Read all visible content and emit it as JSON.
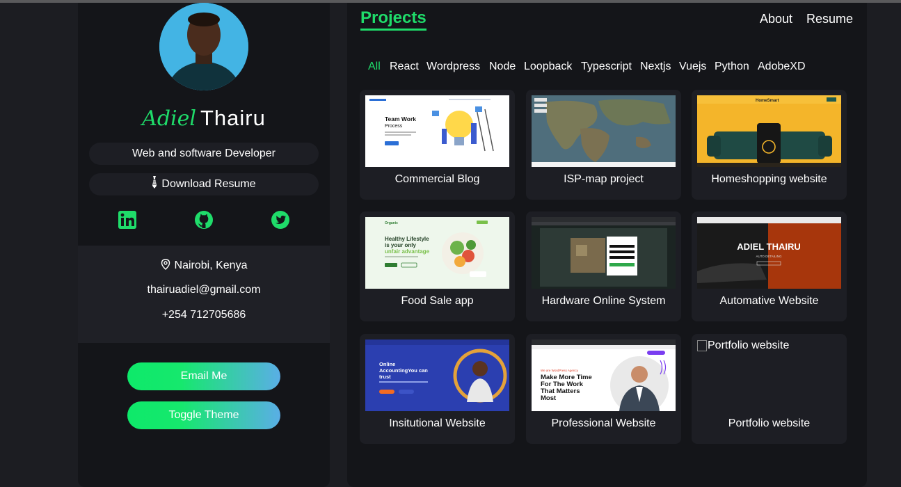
{
  "sidebar": {
    "name_first": "Adiel",
    "name_last": "Thairu",
    "role": "Web and software Developer",
    "download_label": "Download Resume",
    "socials": [
      "linkedin-icon",
      "github-icon",
      "twitter-icon"
    ],
    "location": "Nairobi, Kenya",
    "email": "thairuadiel@gmail.com",
    "phone": "+254 712705686",
    "email_button": "Email Me",
    "theme_button": "Toggle Theme"
  },
  "main": {
    "title": "Projects",
    "nav": {
      "about": "About",
      "resume": "Resume"
    },
    "filters": [
      "All",
      "React",
      "Wordpress",
      "Node",
      "Loopback",
      "Typescript",
      "Nextjs",
      "Vuejs",
      "Python",
      "AdobeXD"
    ],
    "active_filter": "All",
    "projects": [
      {
        "label": "Commercial Blog",
        "thumb": {
          "heading": "Team Work",
          "sub": "Process"
        }
      },
      {
        "label": "ISP-map project"
      },
      {
        "label": "Homeshopping website",
        "thumb": {
          "brand": "HomeSmart"
        }
      },
      {
        "label": "Food Sale app",
        "thumb": {
          "brand": "Organic",
          "line1": "Healthy Lifestyle",
          "line2": "is your only",
          "line3": "unfair advantage"
        }
      },
      {
        "label": "Hardware Online System"
      },
      {
        "label": "Automative Website",
        "thumb": {
          "heading": "ADIEL THAIRU",
          "sub": "AUTO DETAILING"
        }
      },
      {
        "label": "Insitutional Website",
        "thumb": {
          "line1": "Online",
          "line2": "AccountingYou can",
          "line3": "trust"
        }
      },
      {
        "label": "Professional Website",
        "thumb": {
          "kicker": "We are WordPress Agency",
          "line1": "Make More Time",
          "line2": "For The Work",
          "line3": "That Matters",
          "line4": "Most"
        }
      },
      {
        "label": "Portfolio website",
        "thumb": {
          "alt": "Portfolio website"
        }
      }
    ]
  },
  "colors": {
    "accent": "#1fdc6a",
    "panel": "#141519",
    "card": "#1d1e24",
    "page": "#1c1d22"
  }
}
